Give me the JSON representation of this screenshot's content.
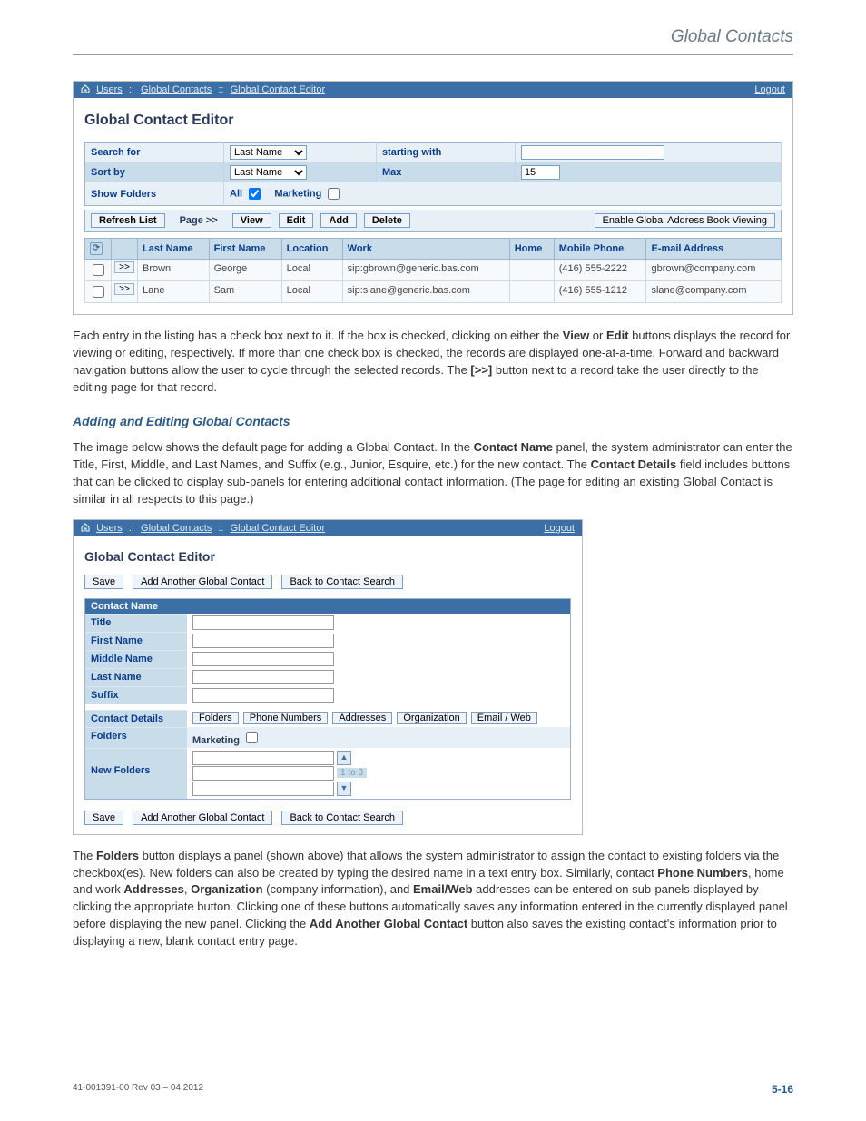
{
  "header": {
    "title": "Global Contacts"
  },
  "shot1": {
    "breadcrumbs": [
      "Users",
      "Global Contacts",
      "Global Contact Editor"
    ],
    "logout": "Logout",
    "title": "Global Contact Editor",
    "labels": {
      "search_for": "Search for",
      "starting_with": "starting with",
      "sort_by": "Sort by",
      "max": "Max",
      "show_folders": "Show Folders",
      "all": "All",
      "marketing": "Marketing"
    },
    "dropdown_option": "Last Name",
    "max_value": "15",
    "actions": {
      "refresh": "Refresh List",
      "page": "Page >>",
      "view": "View",
      "edit": "Edit",
      "add": "Add",
      "delete": "Delete",
      "enable": "Enable Global Address Book Viewing"
    },
    "columns": {
      "last": "Last Name",
      "first": "First Name",
      "location": "Location",
      "work": "Work",
      "home": "Home",
      "mobile": "Mobile Phone",
      "email": "E-mail Address"
    },
    "rows": [
      {
        "last": "Brown",
        "first": "George",
        "loc": "Local",
        "work": "sip:gbrown@generic.bas.com",
        "home": "",
        "mobile": "(416) 555-2222",
        "email": "gbrown@company.com"
      },
      {
        "last": "Lane",
        "first": "Sam",
        "loc": "Local",
        "work": "sip:slane@generic.bas.com",
        "home": "",
        "mobile": "(416) 555-1212",
        "email": "slane@company.com"
      }
    ],
    "goto_btn": ">>"
  },
  "para1": {
    "t1": "Each entry in the listing has a check box next to it. If the box is checked, clicking on either the ",
    "b1": "View",
    "t2": " or ",
    "b2": "Edit",
    "t3": " buttons displays the record for viewing or editing, respectively. If more than one check box is checked, the records are displayed one-at-a-time. Forward and backward navigation buttons allow the user to cycle through the selected records. The ",
    "b3": "[>>]",
    "t4": " button next to a record take the user directly to the editing page for that record."
  },
  "subtitle": "Adding and Editing Global Contacts",
  "para2": {
    "t1": "The image below shows the default page for adding a Global Contact. In the ",
    "b1": "Contact Name",
    "t2": " panel, the system administrator can enter the Title, First, Middle, and Last Names, and Suffix (e.g., Junior, Esquire, etc.) for the new contact. The ",
    "b2": "Contact Details",
    "t3": " field includes buttons that can be clicked to display sub-panels for entering additional contact information. (The page for editing an existing Global Contact is similar in all respects to this page.)"
  },
  "shot2": {
    "breadcrumbs": [
      "Users",
      "Global Contacts",
      "Global Contact Editor"
    ],
    "logout": "Logout",
    "title": "Global Contact Editor",
    "btn_save": "Save",
    "btn_add": "Add Another Global Contact",
    "btn_back": "Back to Contact Search",
    "panel_head": "Contact Name",
    "labels": {
      "title": "Title",
      "first": "First Name",
      "middle": "Middle Name",
      "last": "Last Name",
      "suffix": "Suffix",
      "details": "Contact Details",
      "folders": "Folders",
      "new_folders": "New Folders",
      "marketing": "Marketing"
    },
    "detail_btns": {
      "folders": "Folders",
      "phone": "Phone Numbers",
      "addr": "Addresses",
      "org": "Organization",
      "email": "Email / Web"
    },
    "nf_count": "1 to 3"
  },
  "para3": {
    "t1": "The ",
    "b1": "Folders",
    "t2": " button displays a panel (shown above) that allows the system administrator to assign the contact to existing folders via the checkbox(es). New folders can also be created by typing the desired name in a text entry box. Similarly, contact ",
    "b2": "Phone Numbers",
    "t3": ", home and work ",
    "b3": "Addresses",
    "t4": ", ",
    "b4": "Organization",
    "t5": " (company information), and ",
    "b5": "Email/Web",
    "t6": " addresses can be entered on sub-panels displayed by clicking the appropriate button. Clicking one of these buttons automatically saves any information entered in the currently displayed panel before displaying the new panel. Clicking the ",
    "b6": "Add Another Global Contact",
    "t7": " button also saves the existing contact's information prior to displaying a new, blank contact entry page."
  },
  "footer": {
    "rev": "41-001391-00 Rev 03 – 04.2012",
    "page": "5-16"
  }
}
